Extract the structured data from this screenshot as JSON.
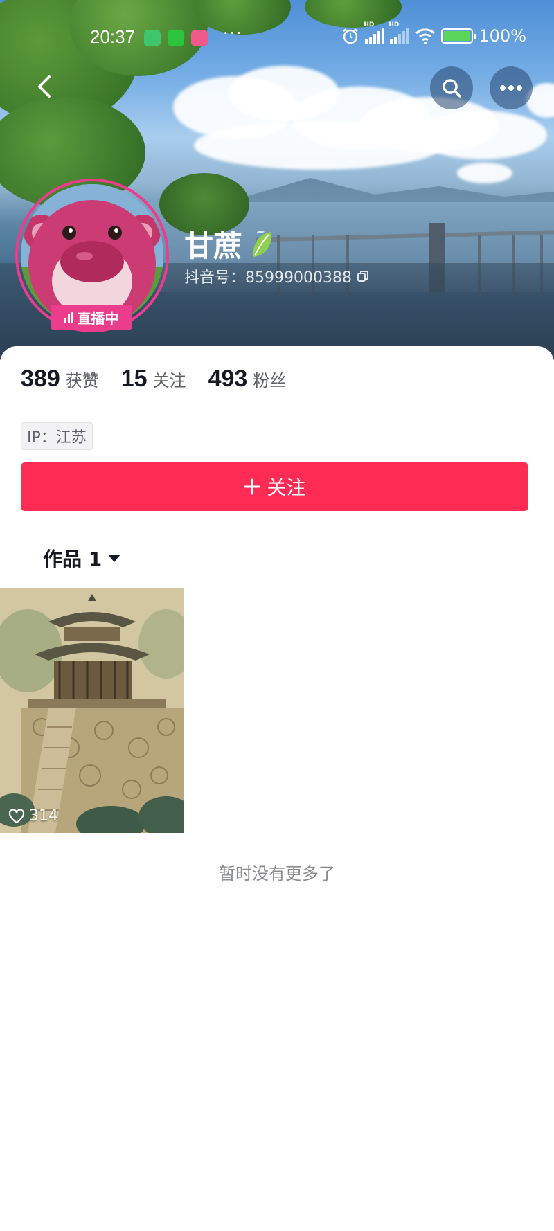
{
  "status_bar": {
    "time": "20:37",
    "battery": "100%"
  },
  "profile": {
    "name": "甘蔗",
    "douyin_id": "抖音号：85999000388",
    "live_badge": "直播中"
  },
  "stats": [
    {
      "value": "389",
      "label": "获赞"
    },
    {
      "value": "15",
      "label": "关注"
    },
    {
      "value": "493",
      "label": "粉丝"
    }
  ],
  "ip_tag": "IP：江苏",
  "follow_button": "关注",
  "works_tab": {
    "label": "作品 1"
  },
  "works": [
    {
      "likes": "314"
    }
  ],
  "no_more_text": "暂时没有更多了",
  "colors": {
    "accent": "#fe2c55",
    "live_pink": "#ec3c8c"
  },
  "icons": {
    "back": "back-arrow-icon",
    "search": "search-icon",
    "more": "more-icon",
    "copy": "copy-icon",
    "heart": "heart-icon",
    "dropdown": "triangle-down-icon",
    "plus": "plus-icon",
    "leaf": "leaf-icon"
  }
}
